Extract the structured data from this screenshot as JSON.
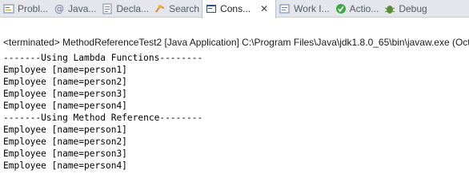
{
  "tabs": [
    {
      "label": "Probl...",
      "icon": "problems-icon"
    },
    {
      "label": "Java...",
      "icon": "javadoc-icon"
    },
    {
      "label": "Decla...",
      "icon": "declaration-icon"
    },
    {
      "label": "Search",
      "icon": "search-icon"
    },
    {
      "label": "Cons...",
      "icon": "console-icon",
      "active": true,
      "close": "✕"
    },
    {
      "label": "Work I...",
      "icon": "work-items-icon"
    },
    {
      "label": "Actio...",
      "icon": "actions-icon"
    },
    {
      "label": "Debug",
      "icon": "debug-icon"
    }
  ],
  "console": {
    "status": "<terminated> MethodReferenceTest2 [Java Application] C:\\Program Files\\Java\\jdk1.8.0_65\\bin\\javaw.exe (Oct ...",
    "lines": [
      "-------Using Lambda Functions--------",
      "Employee [name=person1]",
      "Employee [name=person2]",
      "Employee [name=person3]",
      "Employee [name=person4]",
      "-------Using Method Reference--------",
      "Employee [name=person1]",
      "Employee [name=person2]",
      "Employee [name=person3]",
      "Employee [name=person4]"
    ]
  },
  "colors": {
    "tabbar_bg": "#e4e6ec",
    "active_tab_bg": "#ffffff",
    "console_bg": "#ffffff",
    "text": "#000000"
  }
}
